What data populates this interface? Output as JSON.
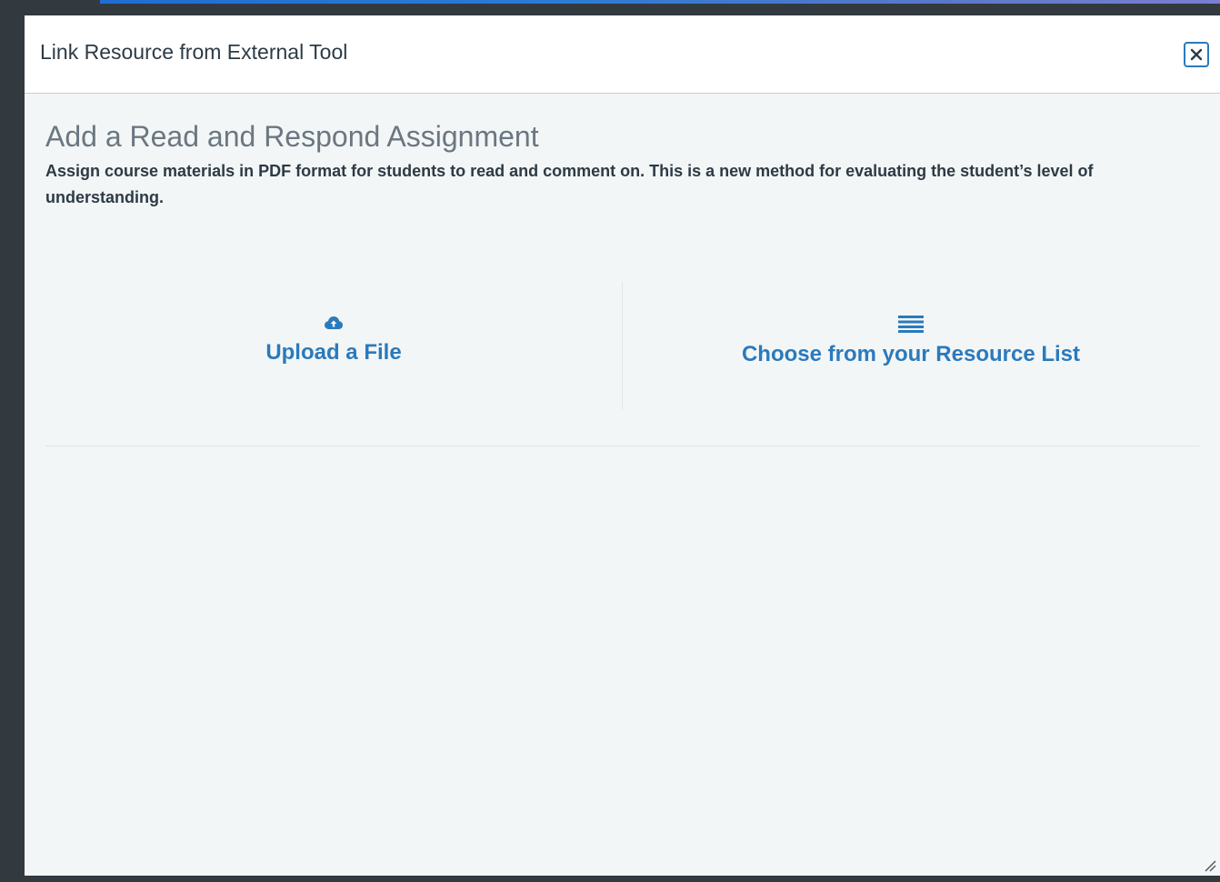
{
  "dialog": {
    "title": "Link Resource from External Tool",
    "close_icon": "close-icon"
  },
  "content": {
    "heading": "Add a Read and Respond Assignment",
    "description": "Assign course materials in PDF format for students to read and comment on. This is a new method for evaluating the student’s level of understanding."
  },
  "options": [
    {
      "label": "Upload a File",
      "icon": "cloud-upload-icon"
    },
    {
      "label": "Choose from your Resource List",
      "icon": "list-icon"
    }
  ],
  "colors": {
    "accent": "#2b7abc",
    "backdrop": "#323a40",
    "panel": "#f3f6f7"
  }
}
